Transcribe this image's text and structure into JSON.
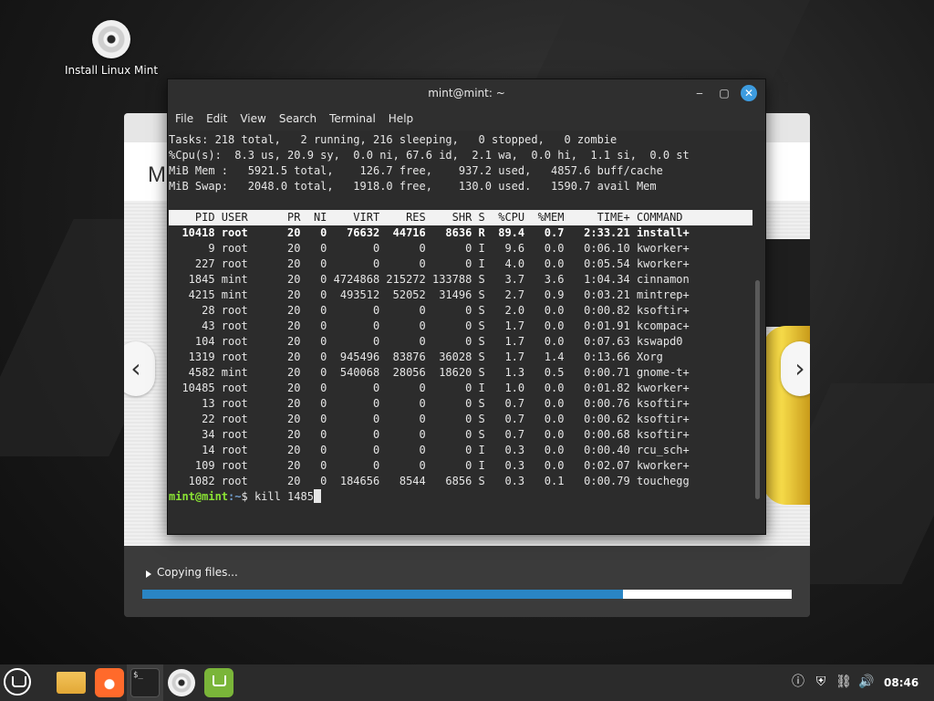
{
  "desktop": {
    "icon_label": "Install Linux Mint"
  },
  "installer": {
    "header_letter": "M",
    "status_text": "Copying files...",
    "progress": 0.74,
    "accent_color": "#2a85c4"
  },
  "terminal": {
    "title": "mint@mint: ~",
    "menu": [
      "File",
      "Edit",
      "View",
      "Search",
      "Terminal",
      "Help"
    ],
    "summary": {
      "tasks": "Tasks: 218 total,   2 running, 216 sleeping,   0 stopped,   0 zombie",
      "cpu": "%Cpu(s):  8.3 us, 20.9 sy,  0.0 ni, 67.6 id,  2.1 wa,  0.0 hi,  1.1 si,  0.0 st",
      "mem": "MiB Mem :   5921.5 total,    126.7 free,    937.2 used,   4857.6 buff/cache",
      "swap": "MiB Swap:   2048.0 total,   1918.0 free,    130.0 used.   1590.7 avail Mem"
    },
    "table_header": "    PID USER      PR  NI    VIRT    RES    SHR S  %CPU  %MEM     TIME+ COMMAND",
    "rows": [
      "  10418 root      20   0   76632  44716   8636 R  89.4   0.7   2:33.21 install+",
      "      9 root      20   0       0      0      0 I   9.6   0.0   0:06.10 kworker+",
      "    227 root      20   0       0      0      0 I   4.0   0.0   0:05.54 kworker+",
      "   1845 mint      20   0 4724868 215272 133788 S   3.7   3.6   1:04.34 cinnamon",
      "   4215 mint      20   0  493512  52052  31496 S   2.7   0.9   0:03.21 mintrep+",
      "     28 root      20   0       0      0      0 S   2.0   0.0   0:00.82 ksoftir+",
      "     43 root      20   0       0      0      0 S   1.7   0.0   0:01.91 kcompac+",
      "    104 root      20   0       0      0      0 S   1.7   0.0   0:07.63 kswapd0",
      "   1319 root      20   0  945496  83876  36028 S   1.7   1.4   0:13.66 Xorg",
      "   4582 mint      20   0  540068  28056  18620 S   1.3   0.5   0:00.71 gnome-t+",
      "  10485 root      20   0       0      0      0 I   1.0   0.0   0:01.82 kworker+",
      "     13 root      20   0       0      0      0 S   0.7   0.0   0:00.76 ksoftir+",
      "     22 root      20   0       0      0      0 S   0.7   0.0   0:00.62 ksoftir+",
      "     34 root      20   0       0      0      0 S   0.7   0.0   0:00.68 ksoftir+",
      "     14 root      20   0       0      0      0 I   0.3   0.0   0:00.40 rcu_sch+",
      "    109 root      20   0       0      0      0 I   0.3   0.0   0:02.07 kworker+",
      "   1082 root      20   0  184656   8544   6856 S   0.3   0.1   0:00.79 touchegg"
    ],
    "prompt_user": "mint@mint",
    "prompt_path": ":~",
    "prompt_symbol": "$ ",
    "command": "kill 1485"
  },
  "taskbar": {
    "clock": "08:46",
    "terminal_icon_text": "$_"
  }
}
